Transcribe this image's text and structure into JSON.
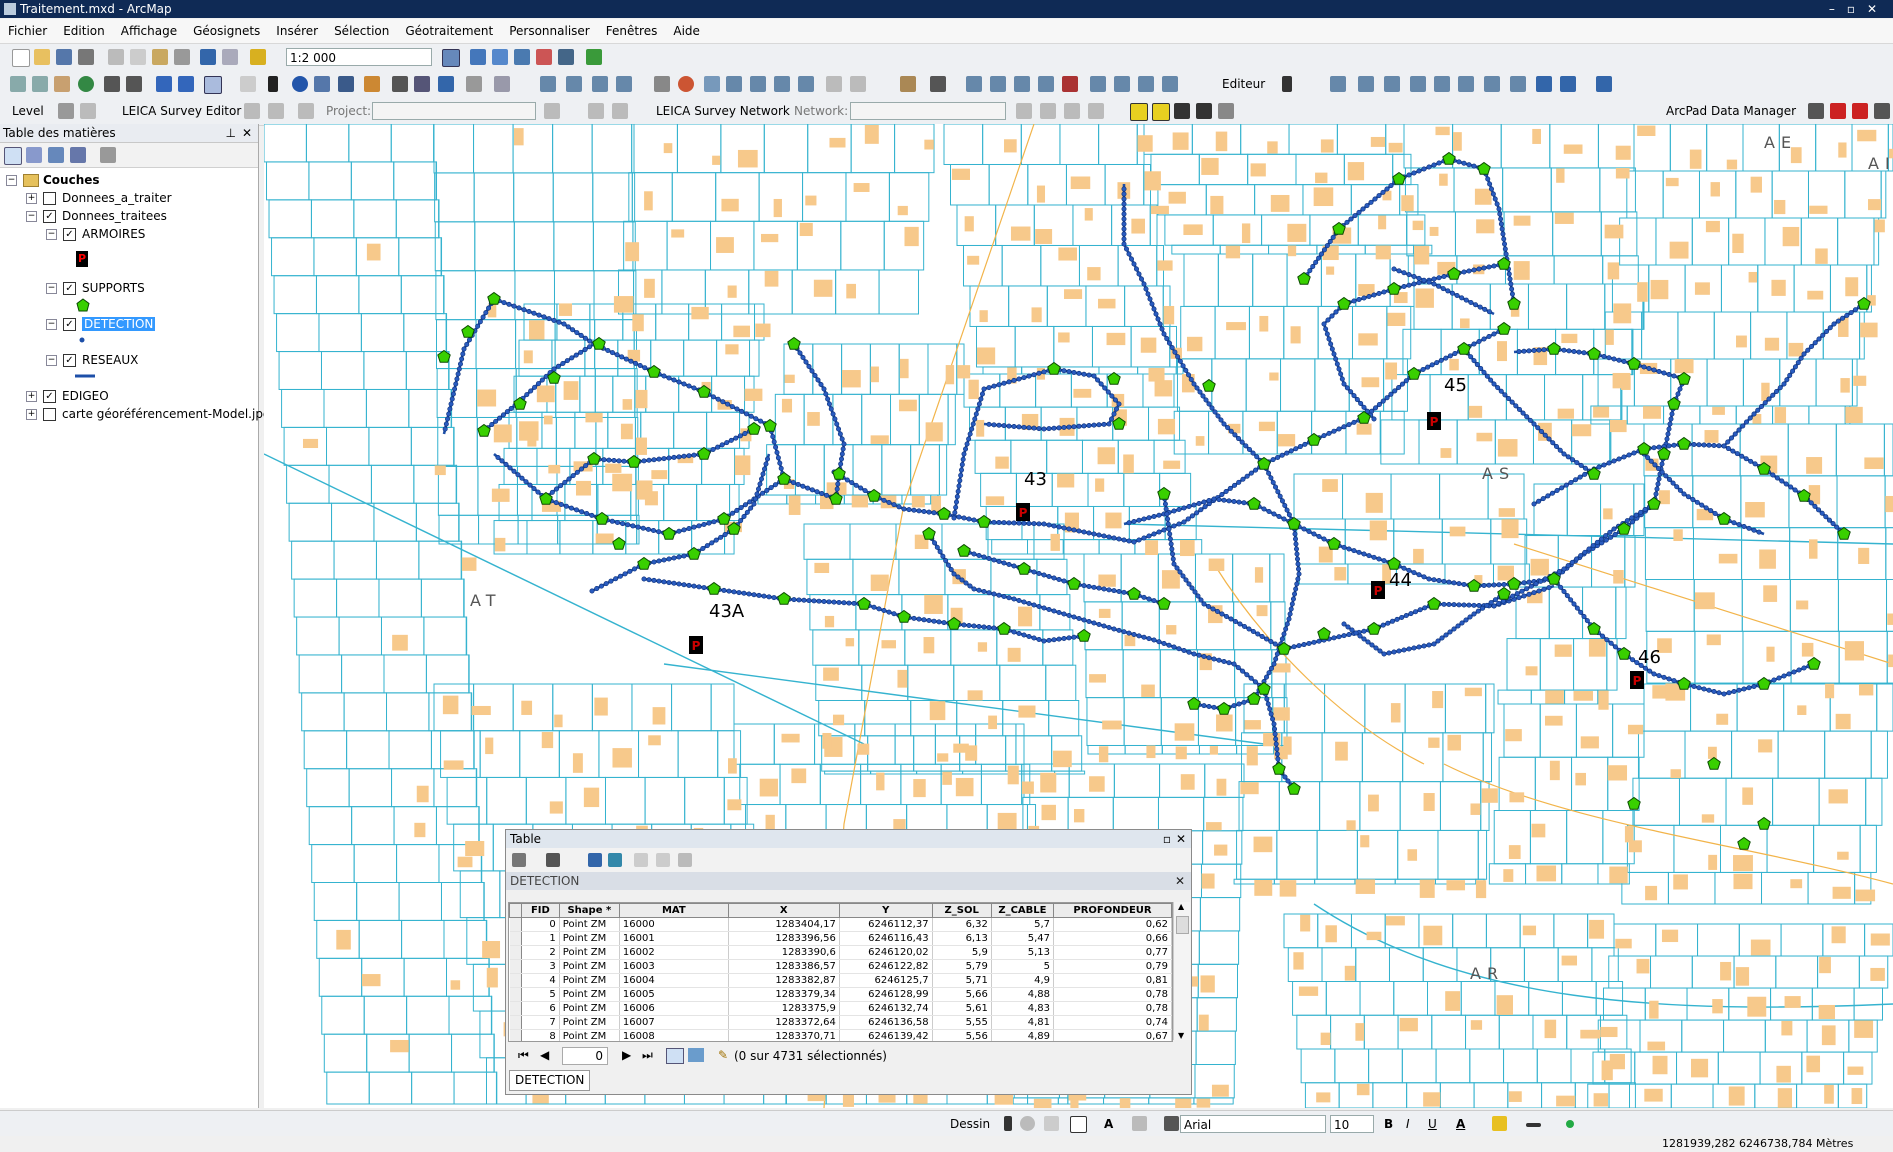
{
  "window": {
    "title": "Traitement.mxd - ArcMap"
  },
  "menu": [
    "Fichier",
    "Edition",
    "Affichage",
    "Géosignets",
    "Insérer",
    "Sélection",
    "Géotraitement",
    "Personnaliser",
    "Fenêtres",
    "Aide"
  ],
  "toolbar": {
    "scale": "1:2 000",
    "editor": "Editeur",
    "level": "Level",
    "leica_editor": "LEICA Survey Editor",
    "project_label": "Project:",
    "leica_network": "LEICA Survey Network",
    "network_label": "Network:",
    "arcpad": "ArcPad Data Manager"
  },
  "toc": {
    "title": "Table des matières",
    "root": "Couches",
    "layers": [
      {
        "name": "Donnees_a_traiter",
        "checked": false,
        "expand": "+"
      },
      {
        "name": "Donnees_traitees",
        "checked": true,
        "expand": "−"
      },
      {
        "name": "ARMOIRES",
        "checked": true,
        "expand": "−"
      },
      {
        "name": "SUPPORTS",
        "checked": true,
        "expand": "−"
      },
      {
        "name": "DETECTION",
        "checked": true,
        "expand": "−"
      },
      {
        "name": "RESEAUX",
        "checked": true,
        "expand": "−"
      },
      {
        "name": "EDIGEO",
        "checked": true,
        "expand": "+"
      },
      {
        "name": "carte géoréférencement-Model.jpg",
        "checked": false,
        "expand": "+"
      }
    ],
    "legend_armoire_glyph": "P"
  },
  "map": {
    "zone_labels": [
      "AE",
      "AT",
      "AS",
      "AR",
      "AI"
    ],
    "cabinet_labels": [
      "43",
      "43A",
      "44",
      "45",
      "46"
    ],
    "cabinet_glyph": "P",
    "colors": {
      "parcel": "#35b3cf",
      "building": "#f7c98b",
      "network": "#1d4fa8",
      "support": "#39d000",
      "cabinet": "#cc0000",
      "road": "#f2b44a"
    }
  },
  "table": {
    "title": "Table",
    "layer": "DETECTION",
    "columns": [
      "FID",
      "Shape *",
      "MAT",
      "X",
      "Y",
      "Z_SOL",
      "Z_CABLE",
      "PROFONDEUR"
    ],
    "rows": [
      [
        "0",
        "Point ZM",
        "16000",
        "1283404,17",
        "6246112,37",
        "6,32",
        "5,7",
        "0,62"
      ],
      [
        "1",
        "Point ZM",
        "16001",
        "1283396,56",
        "6246116,43",
        "6,13",
        "5,47",
        "0,66"
      ],
      [
        "2",
        "Point ZM",
        "16002",
        "1283390,6",
        "6246120,02",
        "5,9",
        "5,13",
        "0,77"
      ],
      [
        "3",
        "Point ZM",
        "16003",
        "1283386,57",
        "6246122,82",
        "5,79",
        "5",
        "0,79"
      ],
      [
        "4",
        "Point ZM",
        "16004",
        "1283382,87",
        "6246125,7",
        "5,71",
        "4,9",
        "0,81"
      ],
      [
        "5",
        "Point ZM",
        "16005",
        "1283379,34",
        "6246128,99",
        "5,66",
        "4,88",
        "0,78"
      ],
      [
        "6",
        "Point ZM",
        "16006",
        "1283375,9",
        "6246132,74",
        "5,61",
        "4,83",
        "0,78"
      ],
      [
        "7",
        "Point ZM",
        "16007",
        "1283372,64",
        "6246136,58",
        "5,55",
        "4,81",
        "0,74"
      ],
      [
        "8",
        "Point ZM",
        "16008",
        "1283370,71",
        "6246139,42",
        "5,56",
        "4,89",
        "0,67"
      ]
    ],
    "record": "0",
    "selection": "(0 sur 4731 sélectionnés)",
    "tab": "DETECTION"
  },
  "drawing": {
    "dessin": "Dessin",
    "font": "Arial",
    "size": "10",
    "bold": "B",
    "italic": "I",
    "underline": "U",
    "text_tool": "A"
  },
  "status": {
    "coords": "1281939,282  6246738,784 Mètres"
  }
}
